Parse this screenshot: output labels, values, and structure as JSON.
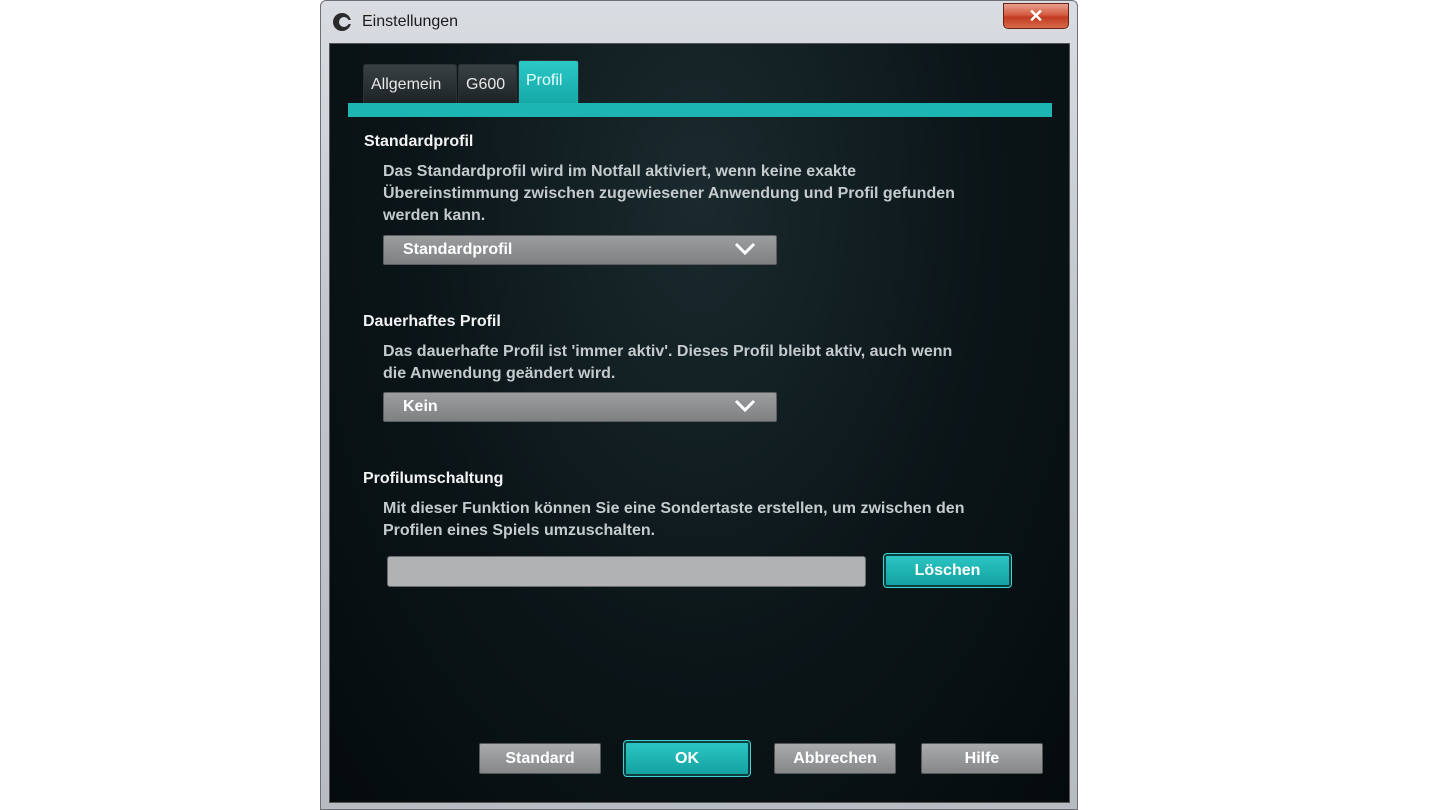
{
  "window": {
    "title": "Einstellungen",
    "close_label": "✕"
  },
  "tabs": [
    {
      "label": "Allgemein",
      "active": false
    },
    {
      "label": "G600",
      "active": false
    },
    {
      "label": "Profil",
      "active": true
    }
  ],
  "standardprofil": {
    "title": "Standardprofil",
    "description_line1": "Das Standardprofil wird im Notfall aktiviert, wenn keine exakte",
    "description_line2": "Übereinstimmung zwischen zugewiesener Anwendung und Profil gefunden",
    "description_line3": "werden kann.",
    "selected": "Standardprofil"
  },
  "dauerhaftes": {
    "title": "Dauerhaftes Profil",
    "description_line1": "Das dauerhafte Profil ist 'immer aktiv'. Dieses Profil bleibt aktiv, auch wenn",
    "description_line2": "die Anwendung geändert wird.",
    "selected": "Kein"
  },
  "profilumschaltung": {
    "title": "Profilumschaltung",
    "description_line1": "Mit dieser Funktion können Sie eine Sondertaste erstellen, um zwischen den",
    "description_line2": "Profilen eines Spiels umzuschalten.",
    "key_value": "",
    "clear_label": "Löschen"
  },
  "footer": {
    "standard_label": "Standard",
    "ok_label": "OK",
    "cancel_label": "Abbrechen",
    "help_label": "Hilfe"
  },
  "colors": {
    "accent": "#1cb5b3",
    "background": "#0b1518"
  },
  "icons": {
    "app": "logitech-logo-icon",
    "close": "close-icon",
    "dropdown": "chevron-down-icon"
  }
}
